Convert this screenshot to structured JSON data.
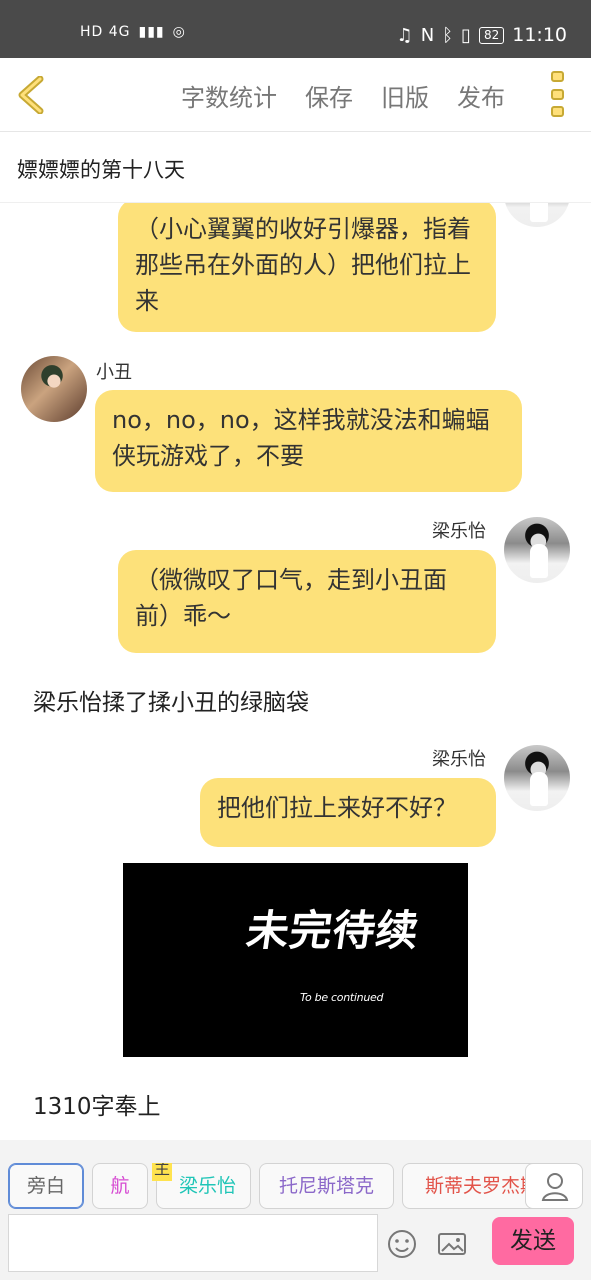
{
  "status": {
    "network": "HD 4G",
    "battery": "82",
    "time": "11:10"
  },
  "topbar": {
    "actions": [
      "字数统计",
      "保存",
      "旧版",
      "发布"
    ]
  },
  "story": {
    "title": "嫖嫖嫖的第十八天"
  },
  "messages": [
    {
      "type": "right",
      "text": "（小心翼翼的收好引爆器，指着那些吊在外面的人）把他们拉上来"
    },
    {
      "type": "left",
      "name": "小丑",
      "text": "no，no，no，这样我就没法和蝙蝠侠玩游戏了，不要"
    },
    {
      "type": "right",
      "name": "梁乐怡",
      "text": "（微微叹了口气，走到小丑面前）乖～"
    },
    {
      "type": "narration",
      "text": "梁乐怡揉了揉小丑的绿脑袋"
    },
    {
      "type": "right",
      "name": "梁乐怡",
      "text": "把他们拉上来好不好？"
    },
    {
      "type": "image",
      "title": "未完待续",
      "subtitle": "To be continued"
    },
    {
      "type": "narration",
      "text": "1310字奉上"
    }
  ],
  "roles": [
    {
      "label": "旁白",
      "color": "#666666"
    },
    {
      "label": "航",
      "color": "#d64ad2"
    },
    {
      "label": "梁乐怡",
      "color": "#20c5b7",
      "badge": "主"
    },
    {
      "label": "托尼斯塔克",
      "color": "#8b68c9"
    },
    {
      "label": "斯蒂夫罗杰斯",
      "color": "#e2544a"
    }
  ],
  "composer": {
    "send": "发送",
    "placeholder": ""
  }
}
